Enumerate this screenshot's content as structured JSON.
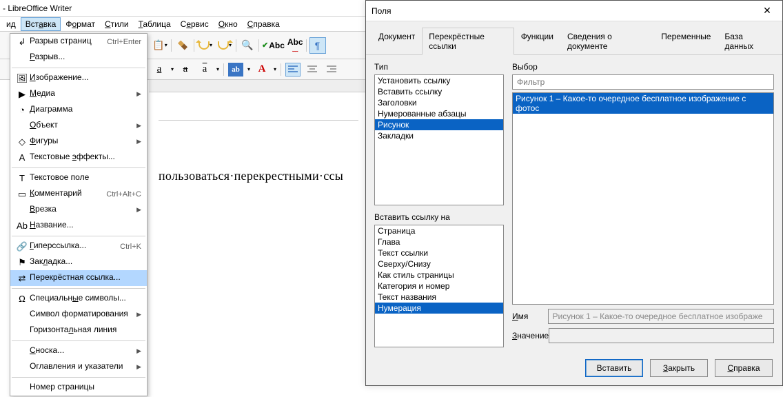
{
  "app_title": "- LibreOffice Writer",
  "menubar": {
    "items": [
      {
        "key": "view",
        "label": "ид",
        "u": ""
      },
      {
        "key": "insert",
        "label": "Вставка",
        "u": "а",
        "active": true
      },
      {
        "key": "format",
        "label": "Формат",
        "u": "о"
      },
      {
        "key": "styles",
        "label": "Стили",
        "u": "С"
      },
      {
        "key": "table",
        "label": "Таблица",
        "u": "Т"
      },
      {
        "key": "service",
        "label": "Сервис",
        "u": "е"
      },
      {
        "key": "window",
        "label": "Окно",
        "u": "О"
      },
      {
        "key": "help",
        "label": "Справка",
        "u": "С"
      }
    ]
  },
  "insert_menu": [
    {
      "icon": "↲",
      "name": "page-break",
      "label": "Разрыв страниц",
      "shortcut": "Ctrl+Enter"
    },
    {
      "name": "break",
      "label": "Разрыв...",
      "u": "Р"
    },
    "-",
    {
      "icon": "🖼",
      "name": "image",
      "label": "Изображение...",
      "u": "И"
    },
    {
      "icon": "▶",
      "name": "media",
      "label": "Медиа",
      "u": "М",
      "submenu": true
    },
    {
      "icon": "◔",
      "name": "chart",
      "label": "Диаграмма",
      "u": "Д"
    },
    {
      "name": "object",
      "label": "Объект",
      "u": "О",
      "submenu": true
    },
    {
      "icon": "◇",
      "name": "shapes",
      "label": "Фигуры",
      "u": "Ф",
      "submenu": true
    },
    {
      "icon": "A",
      "name": "text-effects",
      "label": "Текстовые эффекты...",
      "u": "э"
    },
    "-",
    {
      "icon": "T",
      "name": "text-field",
      "label": "Текстовое поле"
    },
    {
      "icon": "▭",
      "name": "comment",
      "label": "Комментарий",
      "u": "К",
      "shortcut": "Ctrl+Alt+C"
    },
    {
      "name": "frame",
      "label": "Врезка",
      "u": "В",
      "submenu": true
    },
    {
      "icon": "Ab",
      "name": "caption",
      "label": "Название...",
      "u": "Н"
    },
    "-",
    {
      "icon": "🔗",
      "name": "hyperlink",
      "label": "Гиперссылка...",
      "u": "Г",
      "shortcut": "Ctrl+K"
    },
    {
      "icon": "⚑",
      "name": "bookmark",
      "label": "Закладка...",
      "u": "л"
    },
    {
      "icon": "⇄",
      "name": "cross-ref",
      "label": "Перекрёстная ссылка...",
      "highlight": true
    },
    "-",
    {
      "icon": "Ω",
      "name": "special-chars",
      "label": "Специальные символы...",
      "u": "ы"
    },
    {
      "name": "fmt-symbol",
      "label": "Символ форматирования",
      "submenu": true
    },
    {
      "name": "hline",
      "label": "Горизонтальная линия",
      "u": "л"
    },
    "-",
    {
      "name": "footnote",
      "label": "Сноска...",
      "u": "С",
      "submenu": true
    },
    {
      "name": "toc",
      "label": "Оглавления и указатели",
      "submenu": true
    },
    "-",
    {
      "name": "page-number",
      "label": "Номер страницы"
    }
  ],
  "toolbar": {
    "spellcheck": "Abc",
    "pilcrow": "¶"
  },
  "doc_text": "пользоваться·перекрестными·ссы",
  "dialog": {
    "title": "Поля",
    "tabs": [
      "Документ",
      "Перекрёстные ссылки",
      "Функции",
      "Сведения о документе",
      "Переменные",
      "База данных"
    ],
    "active_tab": 1,
    "type_label": "Тип",
    "type_items": [
      "Установить ссылку",
      "Вставить ссылку",
      "Заголовки",
      "Нумерованные абзацы",
      "Рисунок",
      "Закладки"
    ],
    "type_selected": 4,
    "selection_label": "Выбор",
    "filter_placeholder": "Фильтр",
    "selection_items": [
      "Рисунок 1 – Какое-то очередное бесплатное изображение с фотос"
    ],
    "selection_selected": 0,
    "insertref_label": "Вставить ссылку на",
    "insertref_items": [
      "Страница",
      "Глава",
      "Текст ссылки",
      "Сверху/Снизу",
      "Как стиль страницы",
      "Категория и номер",
      "Текст названия",
      "Нумерация"
    ],
    "insertref_selected": 7,
    "name_label": "Имя",
    "name_value": "Рисунок 1 – Какое-то очередное бесплатное изображе",
    "value_label": "Значение",
    "value_value": "",
    "buttons": {
      "insert": "Вставить",
      "close": "Закрыть",
      "help": "Справка"
    }
  }
}
